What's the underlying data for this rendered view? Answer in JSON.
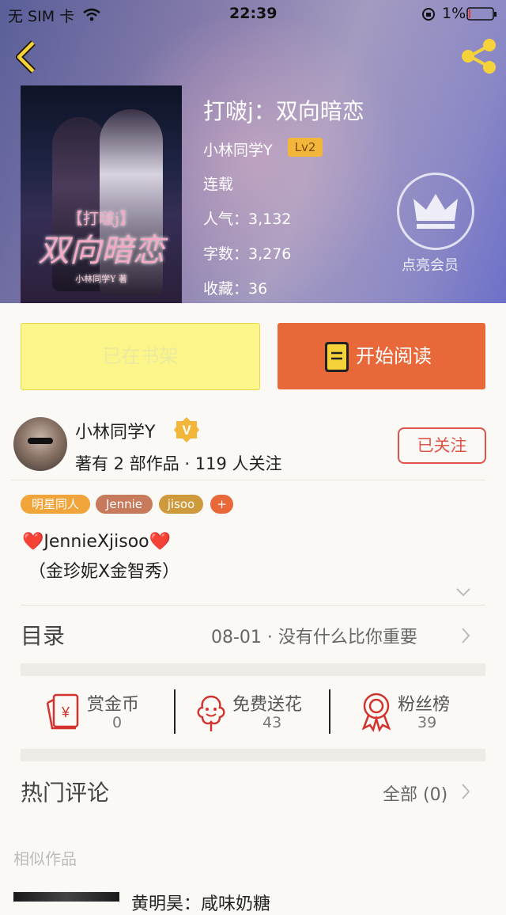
{
  "status_bar": {
    "carrier": "无 SIM 卡",
    "time": "22:39",
    "battery": "1%"
  },
  "book": {
    "title": "打啵j：双向暗恋",
    "author": "小林同学Y",
    "level": "Lv2",
    "status": "连载",
    "popularity": "人气：3,132",
    "words": "字数：3,276",
    "favorites": "收藏：36",
    "cover_title_line1": "【打啵j】",
    "cover_title_line2": "双向暗恋",
    "cover_author": "小林同学Y 著"
  },
  "vip": {
    "label": "点亮会员"
  },
  "buttons": {
    "on_shelf": "已在书架",
    "start_reading": "开始阅读"
  },
  "author_card": {
    "name": "小林同学Y",
    "badge": "V",
    "stats": "著有 2 部作品 · 119 人关注",
    "follow_label": "已关注"
  },
  "tags": [
    {
      "label": "明星同人",
      "color": "#f0a43a"
    },
    {
      "label": "Jennie",
      "color": "#c77a5c"
    },
    {
      "label": "jisoo",
      "color": "#cf9a3c"
    },
    {
      "label": "+",
      "color": "#e8683a"
    }
  ],
  "description": {
    "line1": "❤️JennieXjisoo❤️",
    "line2": "（金珍妮X金智秀）"
  },
  "toc": {
    "label": "目录",
    "latest": "08-01 · 没有什么比你重要"
  },
  "actions": [
    {
      "label": "赏金币",
      "value": "0",
      "icon": "red-envelope-icon"
    },
    {
      "label": "免费送花",
      "value": "43",
      "icon": "flower-icon"
    },
    {
      "label": "粉丝榜",
      "value": "39",
      "icon": "medal-icon"
    }
  ],
  "comments": {
    "label": "热门评论",
    "all": "全部 (0)"
  },
  "similar": {
    "label": "相似作品",
    "first_title": "黄明昊：咸味奶糖"
  },
  "colors": {
    "accent": "#e8683a",
    "follow_red": "#e0534a",
    "shelf_yellow": "#fbf58a"
  }
}
